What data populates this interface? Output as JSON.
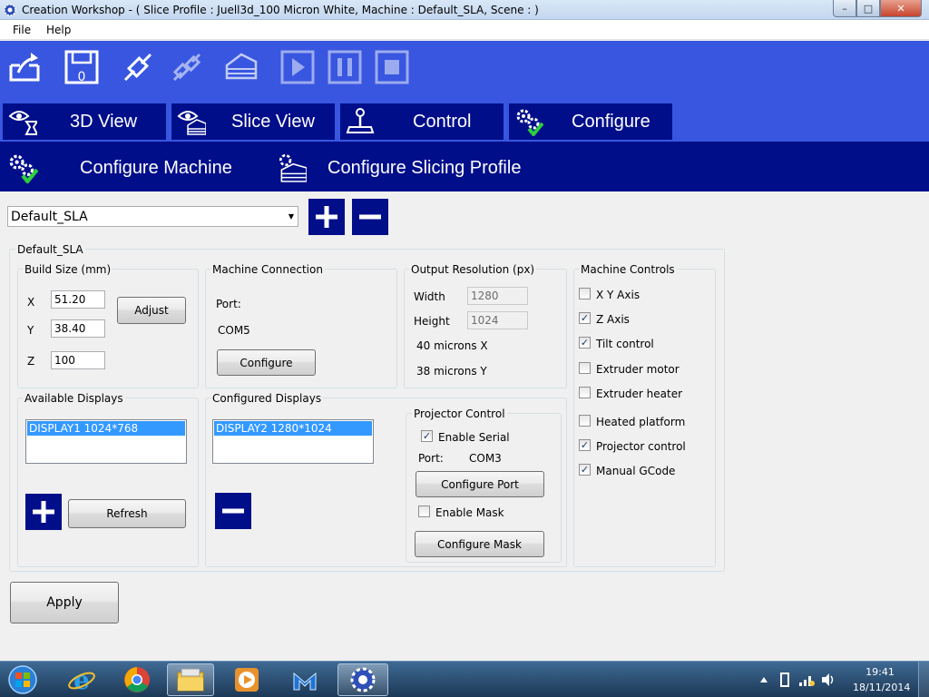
{
  "window": {
    "title": "Creation Workshop -   ( Slice Profile : Juell3d_100 Micron White, Machine : Default_SLA, Scene : )",
    "min_glyph": "–",
    "max_glyph": "□",
    "close_glyph": "✕"
  },
  "menu": {
    "file": "File",
    "help": "Help"
  },
  "toolbar": {
    "icons": [
      "open-icon",
      "save-icon",
      "connect-icon",
      "disconnect-icon",
      "slice-icon",
      "play-icon",
      "pause-icon",
      "stop-icon"
    ]
  },
  "tabs": [
    {
      "label": "3D View",
      "icon": "eye-icon"
    },
    {
      "label": "Slice View",
      "icon": "eye-slices-icon"
    },
    {
      "label": "Control",
      "icon": "joystick-icon"
    },
    {
      "label": "Configure",
      "icon": "gears-check-icon"
    }
  ],
  "subtabs": [
    {
      "label": "Configure Machine",
      "icon": "gears-check-icon"
    },
    {
      "label": "Configure Slicing Profile",
      "icon": "slices-gear-icon"
    }
  ],
  "machine_select": {
    "value": "Default_SLA"
  },
  "machine_group": {
    "title": "Default_SLA"
  },
  "build_size": {
    "title": "Build Size (mm)",
    "x_label": "X",
    "x_value": "51.20",
    "y_label": "Y",
    "y_value": "38.40",
    "z_label": "Z",
    "z_value": "100",
    "adjust": "Adjust"
  },
  "machine_connection": {
    "title": "Machine Connection",
    "port_label": "Port:",
    "port_value": "COM5",
    "configure": "Configure"
  },
  "output_resolution": {
    "title": "Output Resolution (px)",
    "width_label": "Width",
    "width_value": "1280",
    "height_label": "Height",
    "height_value": "1024",
    "microns_x": "40 microns X",
    "microns_y": "38 microns Y"
  },
  "machine_controls": {
    "title": "Machine Controls",
    "items": [
      {
        "label": "X Y Axis",
        "checked": false
      },
      {
        "label": "Z Axis",
        "checked": true
      },
      {
        "label": "Tilt control",
        "checked": true
      },
      {
        "label": "Extruder motor",
        "checked": false
      },
      {
        "label": "Extruder heater",
        "checked": false
      },
      {
        "label": "Heated platform",
        "checked": false
      },
      {
        "label": "Projector control",
        "checked": true
      },
      {
        "label": "Manual GCode",
        "checked": true
      }
    ]
  },
  "available_displays": {
    "title": "Available Displays",
    "items": [
      "DISPLAY1 1024*768"
    ],
    "refresh": "Refresh"
  },
  "configured_displays": {
    "title": "Configured Displays",
    "items": [
      "DISPLAY2 1280*1024"
    ]
  },
  "projector_control": {
    "title": "Projector Control",
    "enable_serial": "Enable Serial",
    "enable_serial_checked": true,
    "port_label": "Port:",
    "port_value": "COM3",
    "configure_port": "Configure Port",
    "enable_mask": "Enable Mask",
    "enable_mask_checked": false,
    "configure_mask": "Configure Mask"
  },
  "apply": "Apply",
  "taskbar": {
    "items": [
      "start-orb-icon",
      "internet-explorer-icon",
      "chrome-icon",
      "file-explorer-icon",
      "media-player-icon",
      "malwarebytes-icon",
      "creation-workshop-icon"
    ],
    "time": "19:41",
    "date": "18/11/2014"
  },
  "colors": {
    "toolbar_blue": "#3856e0",
    "navy": "#000e8a",
    "selection": "#3399ff"
  }
}
